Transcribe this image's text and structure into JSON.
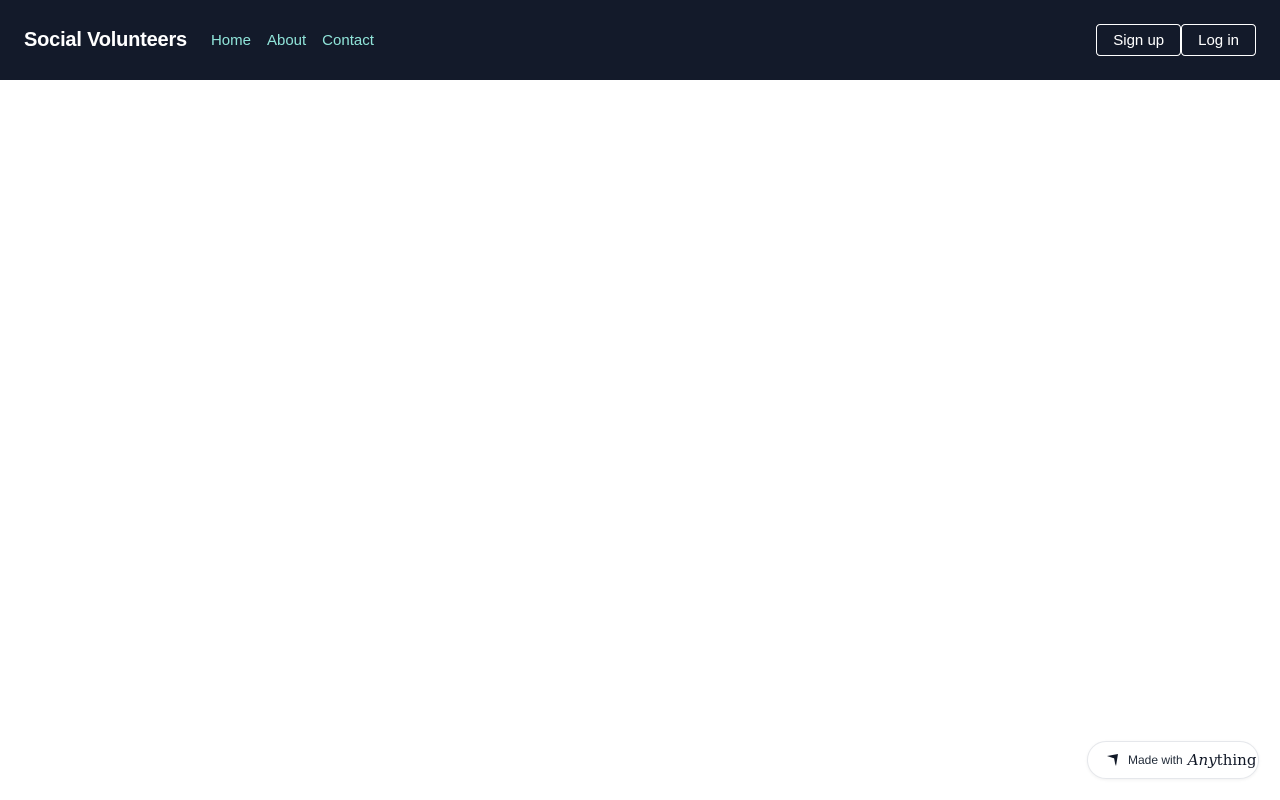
{
  "header": {
    "brand": "Social Volunteers",
    "nav": [
      {
        "label": "Home"
      },
      {
        "label": "About"
      },
      {
        "label": "Contact"
      }
    ],
    "actions": {
      "signup_label": "Sign up",
      "login_label": "Log in"
    }
  },
  "badge": {
    "label": "Made with",
    "brand_italic": "Any",
    "brand_rest": "thing",
    "icon": "anything-logo-icon"
  },
  "colors": {
    "navbar_bg": "#131a2a",
    "nav_link": "#8fe3d8",
    "page_bg": "#ffffff"
  }
}
